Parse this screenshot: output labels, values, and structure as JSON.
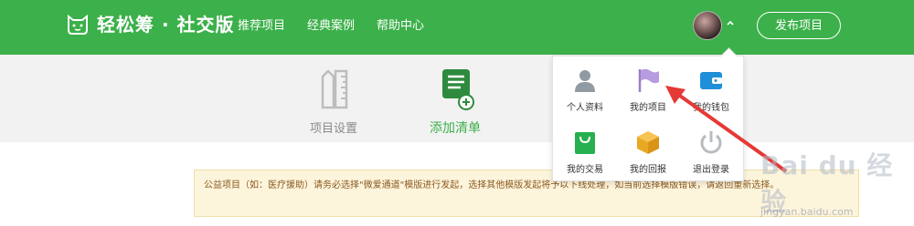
{
  "header": {
    "logo_text": "轻松筹 · 社交版",
    "nav": [
      "推荐项目",
      "经典案例",
      "帮助中心"
    ],
    "publish_label": "发布项目"
  },
  "steps": [
    {
      "label": "项目设置",
      "icon": "ruler-pencil-icon"
    },
    {
      "label": "添加清单",
      "icon": "list-add-icon"
    }
  ],
  "notice": "公益项目（如：医疗援助）请务必选择\"微爱通道\"模版进行发起，选择其他模版发起将予以下线处理，如当前选择模版错误，请返回重新选择。",
  "dropdown": [
    {
      "label": "个人资料",
      "icon": "user-icon"
    },
    {
      "label": "我的项目",
      "icon": "flag-icon"
    },
    {
      "label": "我的钱包",
      "icon": "wallet-icon"
    },
    {
      "label": "我的交易",
      "icon": "shopping-bag-icon"
    },
    {
      "label": "我的回报",
      "icon": "box-icon"
    },
    {
      "label": "退出登录",
      "icon": "power-icon"
    }
  ],
  "watermark": {
    "text": "Bai du 经验",
    "url": "jingyan.baidu.com"
  },
  "colors": {
    "brand_green": "#3cb04a",
    "notice_bg": "#fdf4dc",
    "arrow_red": "#e53935"
  }
}
